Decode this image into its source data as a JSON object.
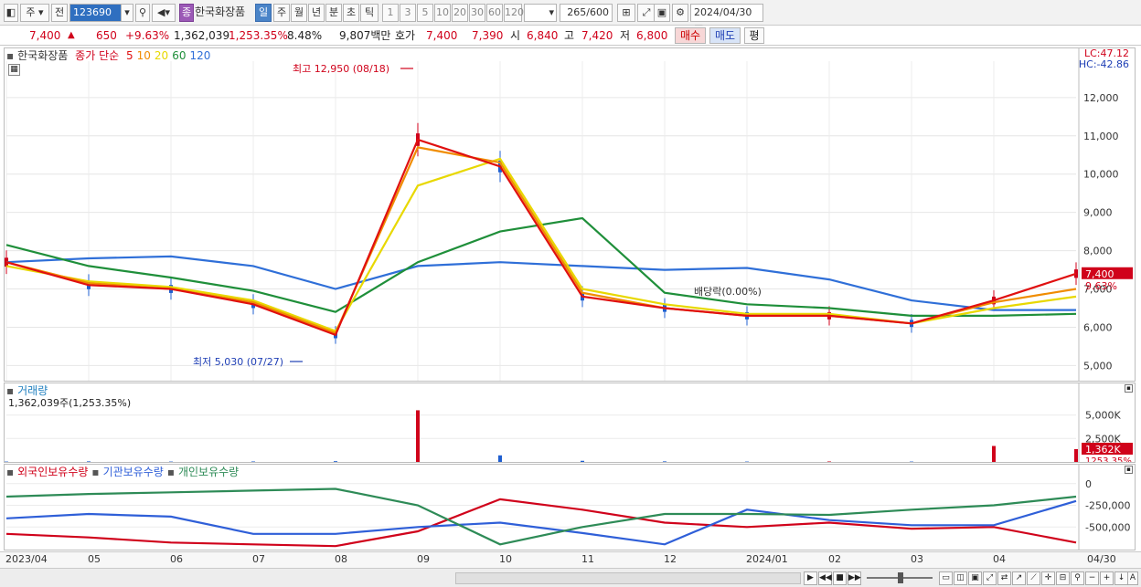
{
  "toolbar": {
    "period_unit": "주",
    "prev_label": "전",
    "stock_code": "123690",
    "jong_badge": "종",
    "stock_name": "한국화장품",
    "periods": [
      "일",
      "주",
      "월",
      "년",
      "분",
      "초",
      "틱"
    ],
    "intervals": [
      "1",
      "3",
      "5",
      "10",
      "20",
      "30",
      "60",
      "120"
    ],
    "count": "265",
    "count_total": "/600",
    "date": "2024/04/30"
  },
  "quote": {
    "price": "7,400",
    "change": "650",
    "change_pct": "+9.63%",
    "volume": "1,362,039",
    "volume_ratio": "1,253.35%",
    "turnover": "8.48%",
    "trade_value": "9,807백만",
    "bid_label": "호가",
    "bid_price1": "7,400",
    "bid_price2": "7,390",
    "open_label": "시",
    "open": "6,840",
    "high_label": "고",
    "high": "7,420",
    "low_label": "저",
    "low": "6,800",
    "buy_button": "매수",
    "sell_button": "매도",
    "eval_button": "평"
  },
  "price_pane": {
    "stock_name": "한국화장품",
    "ma_label": "종가 단순",
    "ma_periods": [
      {
        "label": "5",
        "color": "#e01010"
      },
      {
        "label": "10",
        "color": "#f08c00"
      },
      {
        "label": "20",
        "color": "#e8d800"
      },
      {
        "label": "60",
        "color": "#1f8f3a"
      },
      {
        "label": "120",
        "color": "#2f6fd8"
      }
    ],
    "lc": "LC:47.12",
    "hc": "HC:-42.86",
    "high_annot": "최고 12,950 (08/18)",
    "low_annot": "최저 5,030 (07/27)",
    "dividend_annot": "배당락(0.00%)",
    "last_price_tag": "7,400",
    "last_pct_tag": "9.63%",
    "y_ticks": [
      "12,000",
      "11,000",
      "10,000",
      "9,000",
      "8,000",
      "7,000",
      "6,000",
      "5,000"
    ]
  },
  "volume_pane": {
    "title": "거래량",
    "subtitle": "1,362,039주(1,253.35%)",
    "y_ticks": [
      "5,000K",
      "2,500K"
    ],
    "last_tag": "1,362K",
    "last_pct_tag": "1253.35%"
  },
  "holding_pane": {
    "series": [
      {
        "label": "외국인보유수량",
        "color": "#d0021b"
      },
      {
        "label": "기관보유수량",
        "color": "#2f5fd8"
      },
      {
        "label": "개인보유수량",
        "color": "#2e8b57"
      }
    ],
    "y_ticks": [
      "0",
      "-250,000",
      "-500,000"
    ]
  },
  "x_axis": {
    "labels": [
      "2023/04",
      "05",
      "06",
      "07",
      "08",
      "09",
      "10",
      "11",
      "12",
      "2024/01",
      "02",
      "03",
      "04"
    ],
    "end_label": "04/30"
  },
  "chart_data": {
    "type": "line",
    "title": "",
    "xlabel": "",
    "ylabel": "",
    "x": [
      "2023/04",
      "05",
      "06",
      "07",
      "08",
      "09",
      "10",
      "11",
      "12",
      "2024/01",
      "02",
      "03",
      "04",
      "04/30"
    ],
    "ylim": [
      4700,
      12950
    ],
    "series": [
      {
        "name": "5",
        "color": "#e01010",
        "values": [
          7700,
          7100,
          7000,
          6600,
          5800,
          10900,
          10200,
          6800,
          6500,
          6300,
          6300,
          6100,
          6700,
          7400
        ]
      },
      {
        "name": "10",
        "color": "#f08c00",
        "values": [
          7700,
          7150,
          7000,
          6650,
          5850,
          10700,
          10300,
          6900,
          6500,
          6300,
          6300,
          6100,
          6650,
          7000
        ]
      },
      {
        "name": "20",
        "color": "#e8d800",
        "values": [
          7600,
          7200,
          7050,
          6700,
          5900,
          9700,
          10400,
          7000,
          6600,
          6350,
          6350,
          6100,
          6500,
          6800
        ]
      },
      {
        "name": "60",
        "color": "#1f8f3a",
        "values": [
          8150,
          7600,
          7300,
          6950,
          6400,
          7700,
          8500,
          8850,
          6900,
          6600,
          6500,
          6300,
          6300,
          6350
        ]
      },
      {
        "name": "120",
        "color": "#2f6fd8",
        "values": [
          7700,
          7800,
          7850,
          7600,
          7000,
          7600,
          7700,
          7600,
          7500,
          7550,
          7250,
          6700,
          6450,
          6450
        ]
      }
    ],
    "volume_k": [
      40,
      60,
      40,
      50,
      80,
      5500,
      700,
      120,
      60,
      40,
      50,
      40,
      1700,
      1362
    ],
    "holdings": [
      {
        "name": "외국인보유수량",
        "values": [
          -580000,
          -620000,
          -680000,
          -700000,
          -720000,
          -550000,
          -180000,
          -300000,
          -450000,
          -500000,
          -450000,
          -520000,
          -500000,
          -680000
        ]
      },
      {
        "name": "기관보유수량",
        "values": [
          -400000,
          -350000,
          -380000,
          -580000,
          -580000,
          -500000,
          -450000,
          -570000,
          -700000,
          -300000,
          -420000,
          -480000,
          -480000,
          -200000
        ]
      },
      {
        "name": "개인보유수량",
        "values": [
          -150000,
          -120000,
          -100000,
          -80000,
          -60000,
          -250000,
          -700000,
          -500000,
          -350000,
          -350000,
          -360000,
          -300000,
          -250000,
          -150000
        ]
      }
    ]
  }
}
